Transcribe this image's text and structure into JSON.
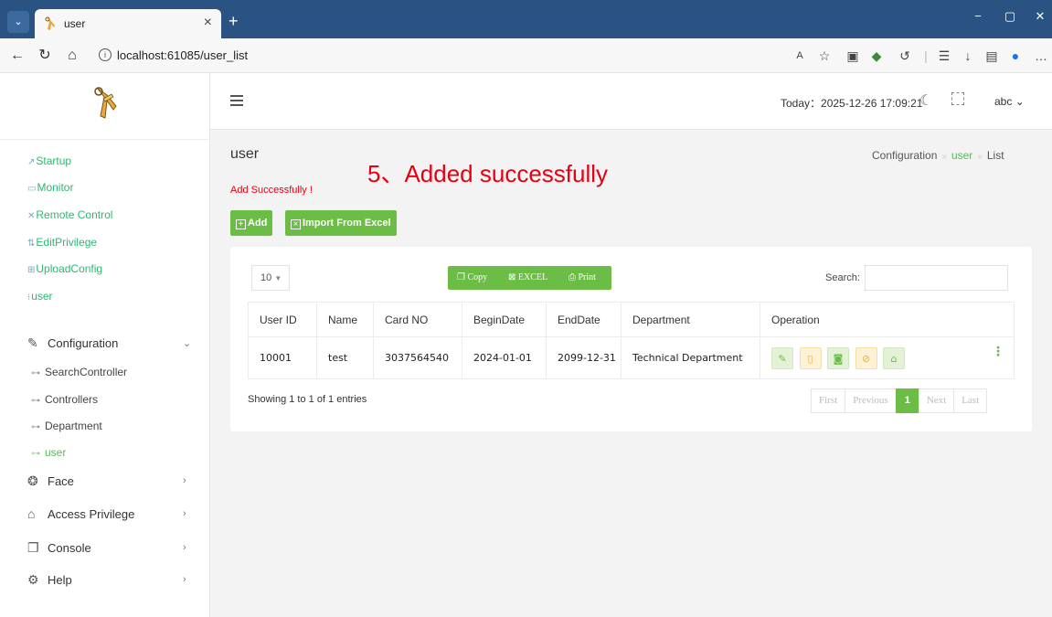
{
  "browser": {
    "tab_title": "user",
    "close_glyph": "×",
    "new_tab_glyph": "+",
    "url": "localhost:61085/user_list",
    "minimize_glyph": "−",
    "maximize_glyph": "▢",
    "close_window_glyph": "✕"
  },
  "sidebar": {
    "links": [
      {
        "label": "Startup",
        "icon": "startup-icon"
      },
      {
        "label": "Monitor",
        "icon": "monitor-icon"
      },
      {
        "label": "Remote Control",
        "icon": "remote-control-icon"
      },
      {
        "label": "EditPrivilege",
        "icon": "edit-privilege-icon"
      },
      {
        "label": "UploadConfig",
        "icon": "upload-config-icon"
      },
      {
        "label": "user",
        "icon": "user-icon"
      }
    ],
    "configuration": {
      "label": "Configuration",
      "children": [
        "SearchController",
        "Controllers",
        "Department",
        "user"
      ]
    },
    "groups": [
      {
        "label": "Face",
        "icon": "face-icon"
      },
      {
        "label": "Access Privilege",
        "icon": "home-icon"
      },
      {
        "label": "Console",
        "icon": "console-icon"
      },
      {
        "label": "Help",
        "icon": "gear-icon"
      }
    ]
  },
  "header": {
    "today": "Today：2025-12-26 17:09:21",
    "user": "abc"
  },
  "page": {
    "title": "user",
    "annotation": "5、Added successfully",
    "flash": "Add Successfully !",
    "breadcrumb": [
      "Configuration",
      "user",
      "List"
    ],
    "add_button": "Add",
    "import_button": "Import From Excel"
  },
  "table": {
    "page_length": "10",
    "export_buttons": [
      "Copy",
      "EXCEL",
      "Print"
    ],
    "search_label": "Search:",
    "search_value": "",
    "columns": [
      "User ID",
      "Name",
      "Card NO",
      "BeginDate",
      "EndDate",
      "Department",
      "Operation"
    ],
    "rows": [
      [
        "10001",
        "test",
        "3037564540",
        "2024-01-01",
        "2099-12-31",
        "Technical Department"
      ]
    ],
    "info": "Showing 1 to 1 of 1 entries",
    "pagination": [
      "First",
      "Previous",
      "1",
      "Next",
      "Last"
    ]
  },
  "colors": {
    "accent": "#6cbd45",
    "annotation": "#e60012",
    "tabbar": "#2a5384"
  }
}
